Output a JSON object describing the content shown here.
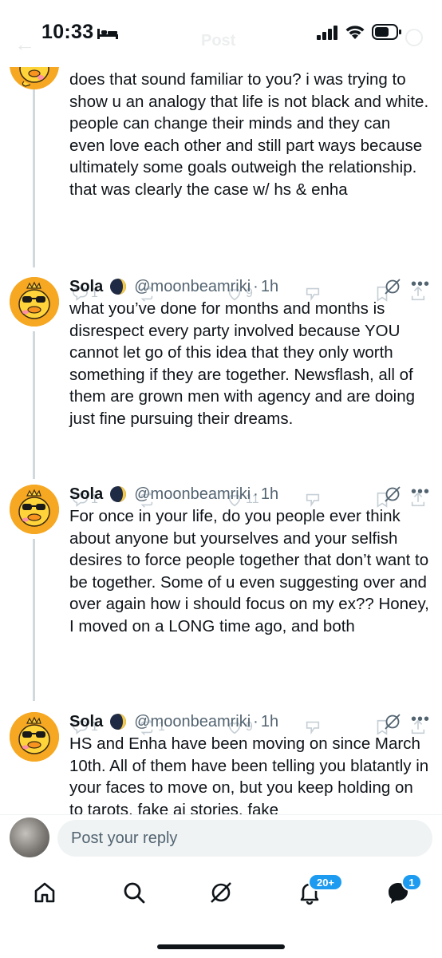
{
  "status_bar": {
    "time": "10:33",
    "ghost_title": "Post",
    "icons": [
      "bed-icon",
      "signal-icon",
      "wifi-icon",
      "battery-icon"
    ]
  },
  "posts": [
    {
      "name": "",
      "handle": "",
      "time": "",
      "text": "does that sound familiar to you? i was trying to show u an analogy that life is not black and white. people can change their minds and they can even love each other and still part ways because ultimately some goals outweigh the relationship. that was clearly the case w/ hs & enha",
      "replies": "1",
      "reposts": "",
      "likes": "9"
    },
    {
      "name": "Sola",
      "handle": "@moonbeamriki",
      "time": "1h",
      "text": "what you’ve done for months and months is disrespect every party involved because YOU cannot let go of this idea that they only worth something if they are together. Newsflash, all of them are grown men with agency and are doing just fine pursuing their dreams.",
      "replies": "1",
      "reposts": "",
      "likes": "11"
    },
    {
      "name": "Sola",
      "handle": "@moonbeamriki",
      "time": "1h",
      "text": "For once in your life, do you people ever think about anyone but yourselves and your selfish desires to force people together that don’t want to be together. Some of u even suggesting over and over again how i should focus on my ex?? Honey, I moved on a LONG time ago, and both",
      "replies": "1",
      "reposts": "1",
      "likes": "9"
    },
    {
      "name": "Sola",
      "handle": "@moonbeamriki",
      "time": "1h",
      "text": "HS and Enha have been moving on since March 10th. All of them have been telling you blatantly in your faces to move on, but you keep holding on to tarots, fake ai stories, fake",
      "replies": "",
      "reposts": "",
      "likes": ""
    }
  ],
  "reply": {
    "placeholder": "Post your reply"
  },
  "bottom_nav": {
    "items": [
      "home-icon",
      "search-icon",
      "grok-icon",
      "notifications-icon",
      "messages-icon"
    ],
    "notifications_badge": "20+",
    "messages_badge": "1"
  },
  "colors": {
    "accent": "#1d9bf0",
    "text": "#0f1419",
    "secondary": "#536471",
    "thread_line": "#cfd9de",
    "avatar_bg": "#f6a823"
  }
}
